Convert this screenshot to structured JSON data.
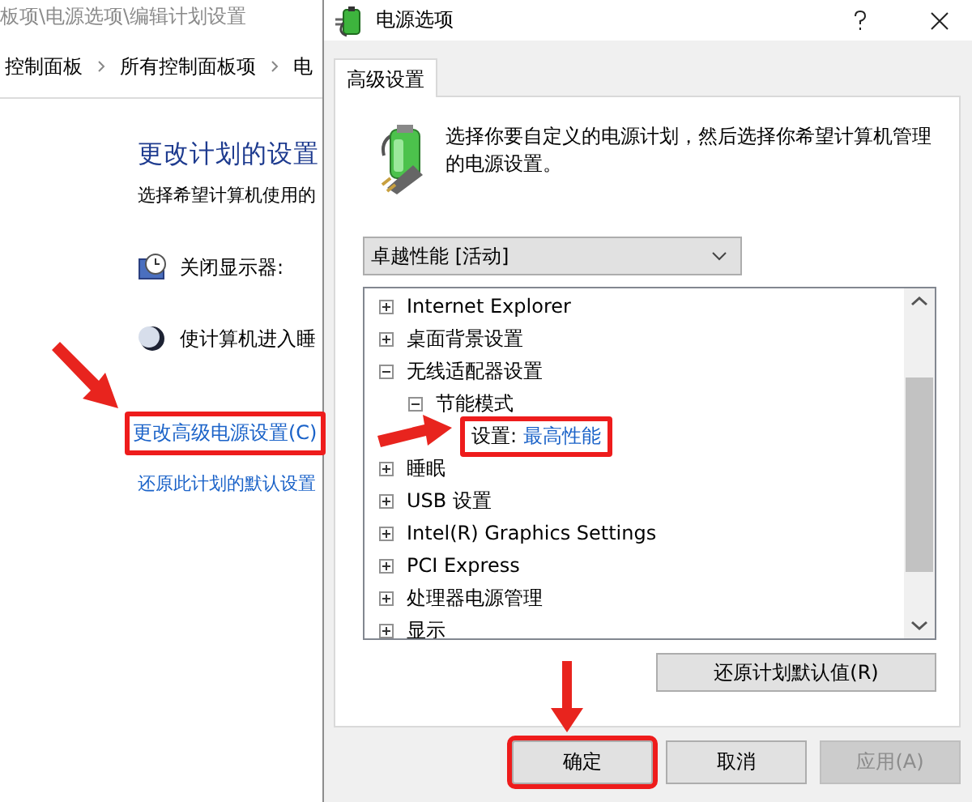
{
  "background_window": {
    "address": "板项\\电源选项\\编辑计划设置",
    "breadcrumb": [
      "控制面板",
      "所有控制面板项",
      "电"
    ],
    "title": "更改计划的设置",
    "subtitle": "选择希望计算机使用的",
    "settings": [
      {
        "kind": "display",
        "label": "关闭显示器:"
      },
      {
        "kind": "sleep",
        "label": "使计算机进入睡"
      }
    ],
    "links": [
      {
        "label": "更改高级电源设置(C)",
        "highlighted": true,
        "arrow": true
      },
      {
        "label": "还原此计划的默认设置",
        "highlighted": false
      }
    ]
  },
  "dialog": {
    "title": "电源选项",
    "tabs": [
      {
        "label": "高级设置",
        "selected": true
      }
    ],
    "description": "选择你要自定义的电源计划，然后选择你希望计算机管理的电源设置。",
    "plan": {
      "value": "卓越性能 [活动]"
    },
    "tree": [
      {
        "label": "Internet Explorer",
        "expanded": false
      },
      {
        "label": "桌面背景设置",
        "expanded": false
      },
      {
        "label": "无线适配器设置",
        "expanded": true,
        "children": [
          {
            "label": "节能模式",
            "expanded": true,
            "children": [
              {
                "kind": "setting",
                "label": "设置:",
                "value": "最高性能",
                "highlighted": true,
                "arrow": true
              }
            ]
          }
        ]
      },
      {
        "label": "睡眠",
        "expanded": false
      },
      {
        "label": "USB 设置",
        "expanded": false
      },
      {
        "label": "Intel(R) Graphics Settings",
        "expanded": false
      },
      {
        "label": "PCI Express",
        "expanded": false
      },
      {
        "label": "处理器电源管理",
        "expanded": false
      },
      {
        "label": "显示",
        "expanded": false
      }
    ],
    "restore_button": "还原计划默认值(R)",
    "buttons": [
      {
        "label": "确定",
        "disabled": false,
        "highlighted": true,
        "arrow": true
      },
      {
        "label": "取消",
        "disabled": false,
        "highlighted": false
      },
      {
        "label": "应用(A)",
        "disabled": true,
        "highlighted": false
      }
    ]
  }
}
